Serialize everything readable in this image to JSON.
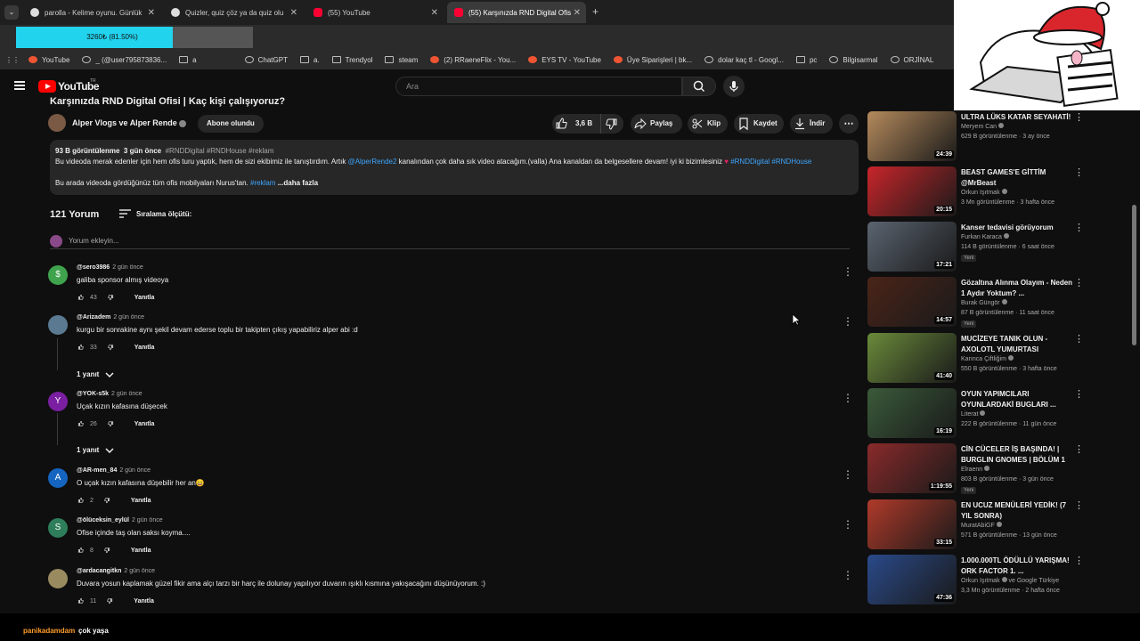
{
  "browser": {
    "tabs": [
      {
        "title": "parolla - Kelime oyunu. Günlük",
        "active": false
      },
      {
        "title": "Quizler, quiz çöz ya da quiz olu",
        "active": false
      },
      {
        "title": "(55) YouTube",
        "active": false
      },
      {
        "title": "(55) Karşınızda RND Digital Ofis",
        "active": true
      }
    ],
    "progress_text": "3260₺ (81.50%)",
    "progress_percent": 81.5,
    "bookmarks": [
      "YouTube",
      "_ (@user795873836...",
      "a",
      "ChatGPT",
      "a.",
      "Trendyol",
      "steam",
      "(2) RRaeneFlix - You...",
      "EYS TV - YouTube",
      "Üye Siparişleri | bk...",
      "dolar kaç tl - Googl...",
      "pc",
      "Bilgisarmal",
      "ORJİNAL"
    ]
  },
  "youtube": {
    "logo": "YouTube",
    "region": "TR",
    "search_placeholder": "Ara"
  },
  "video": {
    "title": "Karşınızda RND Digital Ofisi | Kaç kişi çalışıyoruz?",
    "channel": "Alper Vlogs ve Alper Rende",
    "subscribe_label": "Abone olundu",
    "likes": "3,6 B",
    "share_label": "Paylaş",
    "clip_label": "Klip",
    "save_label": "Kaydet",
    "download_label": "İndir",
    "views": "93 B görüntülenme",
    "uploaded": "3 gün önce",
    "tags": "#RNDDigital #RNDHouse #reklam",
    "desc_line1_a": "Bu videoda merak edenler için hem ofis turu yaptık, hem de sizi ekibimiz ile tanıştırdım. Artık",
    "desc_mention": "@AlperRende2",
    "desc_line1_b": "kanalından çok daha sık video atacağım.(valla) Ana kanaldan da belgesellere devam! iyi ki bizimlesiniz",
    "desc_line1_tags": "#RNDDigital #RNDHouse",
    "desc_line2": "Bu arada videoda gördüğünüz tüm ofis mobilyaları Nurus'tan.",
    "desc_line2_tag": "#reklam",
    "more_label": "...daha fazla"
  },
  "comments_section": {
    "count_label": "121 Yorum",
    "sort_label": "Sıralama ölçütü:",
    "add_placeholder": "Yorum ekleyin...",
    "reply_label": "Yanıtla",
    "replies_toggle": "1 yanıt",
    "items": [
      {
        "user": "@sero3986",
        "ago": "2 gün önce",
        "text": "galiba sponsor almış videoya",
        "likes": "43",
        "avatar_letter": "$",
        "avatar_color": "#3fa34d"
      },
      {
        "user": "@Arizadem",
        "ago": "2 gün önce",
        "text": "kurgu bir sonrakine aynı şekil devam ederse toplu bir takipten çıkış yapabiliriz alper abi :d",
        "likes": "33",
        "avatar_letter": "",
        "avatar_color": "#5b7a92"
      },
      {
        "user": "@YOK-s5k",
        "ago": "2 gün önce",
        "text": "Uçak kızın kafasına düşecek",
        "likes": "26",
        "avatar_letter": "Y",
        "avatar_color": "#7b1fa2"
      },
      {
        "user": "@AR-men_84",
        "ago": "2 gün önce",
        "text": "O uçak kızın kafasına düşebilir her an😄",
        "likes": "2",
        "avatar_letter": "A",
        "avatar_color": "#1565c0"
      },
      {
        "user": "@ölüceksin_eylül",
        "ago": "2 gün önce",
        "text": "Ofise içinde taş olan saksı koyma....",
        "likes": "8",
        "avatar_letter": "S",
        "avatar_color": "#2e7d5b"
      },
      {
        "user": "@ardacangitkn",
        "ago": "2 gün önce",
        "text": "Duvara yosun kaplamak güzel fikir ama alçı tarzı bir harç ile dolunay yapılıyor duvarın ışıklı kısmına yakışacağını düşünüyorum. :)",
        "likes": "11",
        "avatar_letter": "",
        "avatar_color": "#9a8a60"
      }
    ]
  },
  "sidebar": {
    "items": [
      {
        "title": "ULTRA LÜKS KATAR SEYAHATİ!",
        "channel": "Meryem Can",
        "meta": "629 B görüntülenme · 3 ay önce",
        "duration": "24:39",
        "new": "",
        "thumb_color": "#b58a5c"
      },
      {
        "title": "BEAST GAMES'E GİTTİM @MrBeast",
        "channel": "Orkun Işıtmak",
        "meta": "3 Mn görüntülenme · 3 hafta önce",
        "duration": "20:15",
        "new": "",
        "thumb_color": "#c8252a"
      },
      {
        "title": "Kanser tedavisi görüyorum",
        "channel": "Furkan Karaca",
        "meta": "114 B görüntülenme · 6 saat önce",
        "duration": "17:21",
        "new": "Yeni",
        "thumb_color": "#5a6470"
      },
      {
        "title": "Gözaltına Alınma Olayım - Neden 1 Aydır Yoktum? ...",
        "channel": "Burak Güngör",
        "meta": "87 B görüntülenme · 11 saat önce",
        "duration": "14:57",
        "new": "Yeni",
        "thumb_color": "#4a2418"
      },
      {
        "title": "MUCİZEYE TANIK OLUN - AXOLOTL YUMURTASI",
        "channel": "Karınca Çiftliğim",
        "meta": "550 B görüntülenme · 3 hafta önce",
        "duration": "41:40",
        "new": "",
        "thumb_color": "#6a8a3a"
      },
      {
        "title": "OYUN YAPIMCILARI OYUNLARDAKİ BUGLARI ...",
        "channel": "Literat",
        "meta": "222 B görüntülenme · 11 gün önce",
        "duration": "16:19",
        "new": "",
        "thumb_color": "#3a5a3a"
      },
      {
        "title": "CİN CÜCELER İŞ BAŞINDA! | BURGLIN GNOMES | BÖLÜM 1",
        "channel": "Elraenn",
        "meta": "803 B görüntülenme · 3 gün önce",
        "duration": "1:19:55",
        "new": "Yeni",
        "thumb_color": "#8a2a2a"
      },
      {
        "title": "EN UCUZ MENÜLERİ YEDİK! (7 YIL SONRA)",
        "channel": "MuratAbiGF",
        "meta": "571 B görüntülenme · 13 gün önce",
        "duration": "33:15",
        "new": "",
        "thumb_color": "#b03a2a"
      },
      {
        "title": "1.000.000TL ÖDÜLLÜ YARIŞMA! ORK FACTOR 1. ...",
        "channel": "Orkun Işıtmak",
        "channel_extra": "ve Google Türkiye",
        "meta": "3,3 Mn görüntülenme · 2 hafta önce",
        "duration": "47:36",
        "new": "",
        "thumb_color": "#2a4a8a"
      }
    ]
  },
  "stream_chat": {
    "user": "panikadamdam",
    "message": "çok yaşa"
  }
}
